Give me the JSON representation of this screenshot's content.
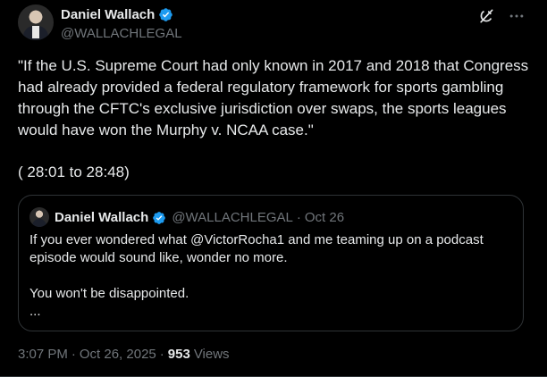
{
  "colors": {
    "background": "#000000",
    "text_primary": "#e7e9ea",
    "text_secondary": "#71767b",
    "verified_badge": "#1d9bf0",
    "border": "#2f3336"
  },
  "author": {
    "display_name": "Daniel Wallach",
    "handle": "@WALLACHLEGAL",
    "verified_icon": "verified-badge-icon"
  },
  "actions": {
    "grok_icon": "grok-icon",
    "more_icon": "more-options-icon"
  },
  "tweet": {
    "text": "\"If the U.S. Supreme Court had only known in 2017 and 2018 that Congress had already provided a federal regulatory framework for sports gambling through the CFTC's exclusive jurisdiction over swaps, the sports leagues would have won the Murphy v. NCAA case.\"",
    "timecode": "( 28:01 to 28:48)"
  },
  "quoted_tweet": {
    "display_name": "Daniel Wallach",
    "handle": "@WALLACHLEGAL",
    "separator": "·",
    "date": "Oct 26",
    "line1": "If you ever wondered what @VictorRocha1 and me teaming up on a podcast episode would sound like, wonder no more.",
    "line2": "You won't be disappointed.",
    "line3": "..."
  },
  "meta": {
    "time": "3:07 PM",
    "separator1": "·",
    "date": "Oct 26, 2025",
    "separator2": "·",
    "views_count": "953",
    "views_label": "Views"
  }
}
